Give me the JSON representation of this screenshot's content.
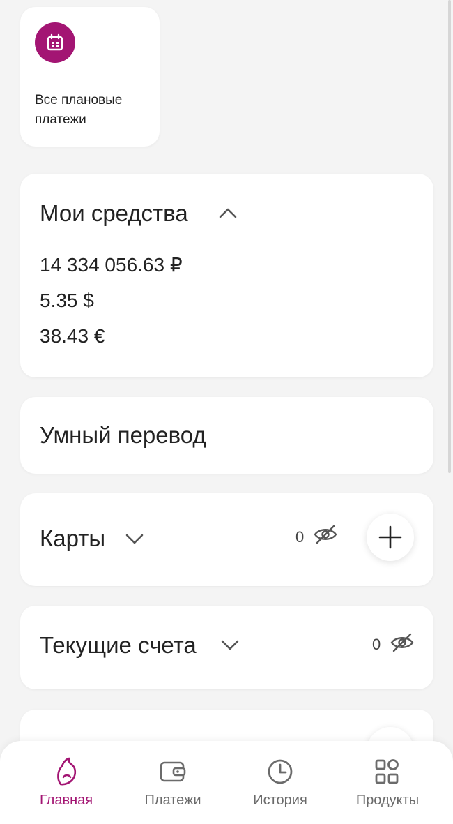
{
  "colors": {
    "accent": "#a31573",
    "background": "#f4f4f4",
    "card": "#ffffff"
  },
  "scheduled_tile": {
    "icon": "calendar-icon",
    "label": "Все плановые платежи"
  },
  "my_funds": {
    "title": "Мои средства",
    "expanded": true,
    "balances": [
      "14 334 056.63 ₽",
      "5.35 $",
      "38.43 €"
    ]
  },
  "smart_transfer": {
    "title": "Умный перевод"
  },
  "cards": {
    "title": "Карты",
    "hidden_count": "0",
    "add_icon": "plus-icon"
  },
  "current_accounts": {
    "title": "Текущие счета",
    "hidden_count": "0"
  },
  "bottom_nav": {
    "items": [
      {
        "label": "Главная",
        "icon": "home-logo-icon",
        "active": true
      },
      {
        "label": "Платежи",
        "icon": "wallet-icon",
        "active": false
      },
      {
        "label": "История",
        "icon": "clock-icon",
        "active": false
      },
      {
        "label": "Продукты",
        "icon": "grid-icon",
        "active": false
      }
    ]
  }
}
